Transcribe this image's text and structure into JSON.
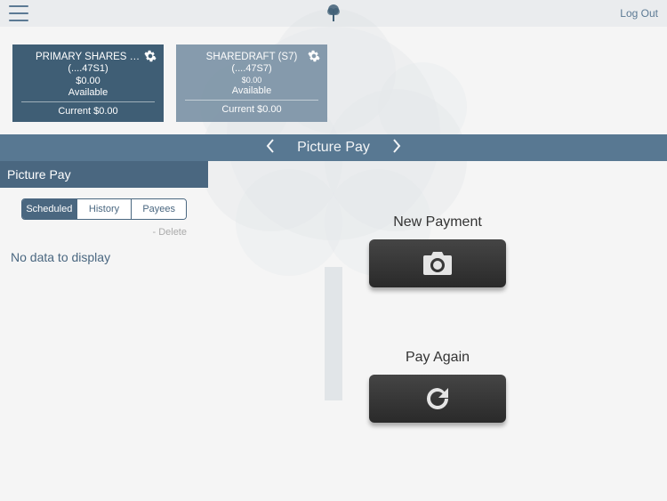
{
  "header": {
    "logout": "Log Out"
  },
  "accounts": [
    {
      "name": "PRIMARY SHARES (....",
      "acctnum": "(....47S1)",
      "balance": "$0.00",
      "available_label": "Available",
      "current": "Current $0.00"
    },
    {
      "name": "SHAREDRAFT (S7)",
      "acctnum": "(....47S7)",
      "balance": "$0.00",
      "available_label": "Available",
      "current": "Current $0.00"
    }
  ],
  "feature_bar": {
    "title": "Picture Pay"
  },
  "sidebar": {
    "header": "Picture Pay",
    "segments": [
      "Scheduled",
      "History",
      "Payees"
    ],
    "active_segment": 0,
    "delete": "- Delete",
    "no_data": "No data to display"
  },
  "actions": {
    "new_payment": {
      "label": "New Payment"
    },
    "pay_again": {
      "label": "Pay Again"
    }
  }
}
